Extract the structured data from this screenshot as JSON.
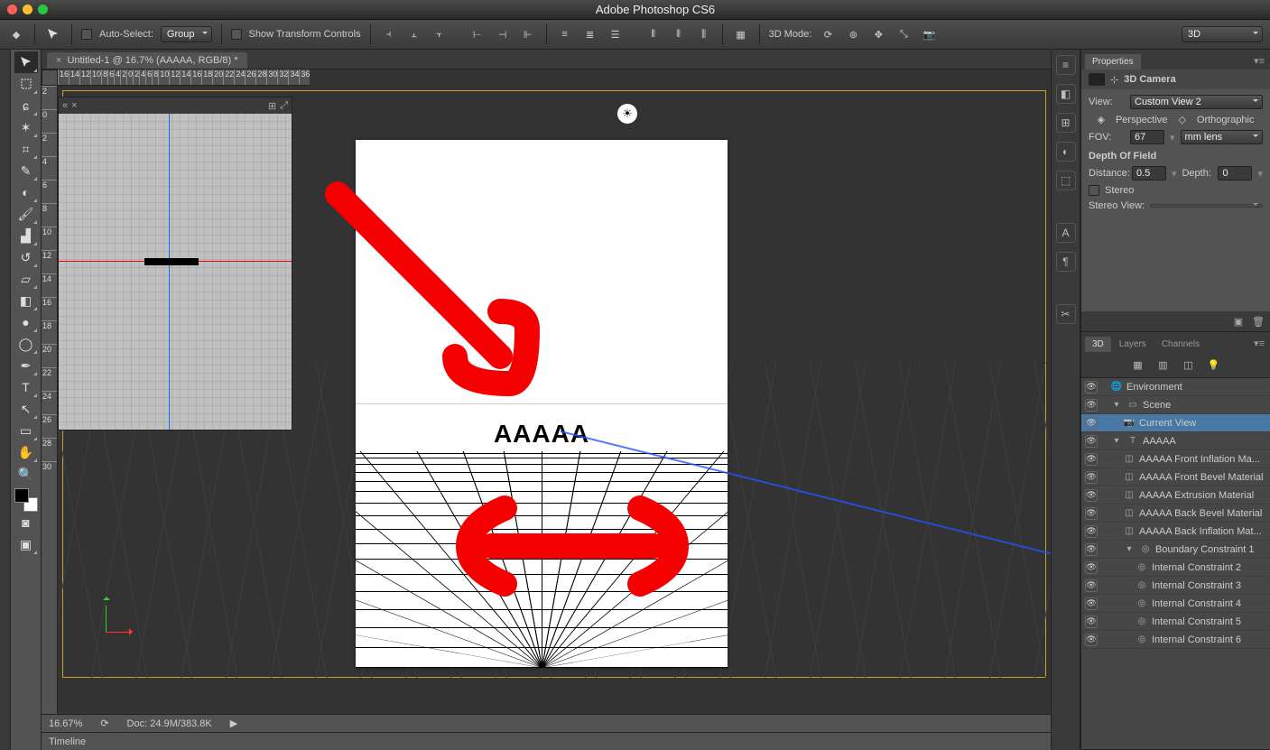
{
  "titlebar": {
    "title": "Adobe Photoshop CS6"
  },
  "options": {
    "auto_select_label": "Auto-Select:",
    "auto_select_target": "Group",
    "show_transform_label": "Show Transform Controls",
    "mode_3d_label": "3D Mode:",
    "right_dd": "3D"
  },
  "document": {
    "tab_label": "Untitled-1 @ 16.7% (AAAAA, RGB/8) *",
    "zoom": "16.67%",
    "doc_size": "Doc: 24.9M/383.8K",
    "artboard_text": "AAAAA"
  },
  "ruler_h": [
    "16",
    "14",
    "12",
    "10",
    "8",
    "6",
    "4",
    "2",
    "0",
    "2",
    "4",
    "6",
    "8",
    "10",
    "12",
    "14",
    "16",
    "18",
    "20",
    "22",
    "24",
    "26",
    "28",
    "30",
    "32",
    "34",
    "36"
  ],
  "ruler_v": [
    "2",
    "0",
    "2",
    "4",
    "6",
    "8",
    "10",
    "12",
    "14",
    "16",
    "18",
    "20",
    "22",
    "24",
    "26",
    "28",
    "30"
  ],
  "timeline": {
    "label": "Timeline"
  },
  "properties": {
    "tab": "Properties",
    "header": "3D Camera",
    "view_label": "View:",
    "view_value": "Custom View 2",
    "perspective_label": "Perspective",
    "orthographic_label": "Orthographic",
    "fov_label": "FOV:",
    "fov_value": "67",
    "fov_unit": "mm lens",
    "dof_label": "Depth Of Field",
    "distance_label": "Distance:",
    "distance_value": "0.5",
    "depth_label": "Depth:",
    "depth_value": "0",
    "stereo_label": "Stereo",
    "stereo_view_label": "Stereo View:"
  },
  "panel3d": {
    "tabs": [
      "3D",
      "Layers",
      "Channels"
    ],
    "items": [
      {
        "indent": 0,
        "icon": "🌐",
        "label": "Environment",
        "eye": true
      },
      {
        "indent": 0,
        "icon": "▭",
        "label": "Scene",
        "eye": true,
        "disclose": "▾"
      },
      {
        "indent": 1,
        "icon": "📷",
        "label": "Current View",
        "eye": true,
        "sel": true
      },
      {
        "indent": 0,
        "icon": "T",
        "label": "AAAAA",
        "eye": true,
        "disclose": "▾"
      },
      {
        "indent": 1,
        "icon": "◫",
        "label": "AAAAA Front Inflation Ma...",
        "eye": true
      },
      {
        "indent": 1,
        "icon": "◫",
        "label": "AAAAA Front Bevel Material",
        "eye": true
      },
      {
        "indent": 1,
        "icon": "◫",
        "label": "AAAAA Extrusion Material",
        "eye": true
      },
      {
        "indent": 1,
        "icon": "◫",
        "label": "AAAAA Back Bevel Material",
        "eye": true
      },
      {
        "indent": 1,
        "icon": "◫",
        "label": "AAAAA Back Inflation Mat...",
        "eye": true
      },
      {
        "indent": 1,
        "icon": "◎",
        "label": "Boundary Constraint 1",
        "eye": true,
        "disclose": "▾"
      },
      {
        "indent": 2,
        "icon": "◎",
        "label": "Internal Constraint 2",
        "eye": true
      },
      {
        "indent": 2,
        "icon": "◎",
        "label": "Internal Constraint 3",
        "eye": true
      },
      {
        "indent": 2,
        "icon": "◎",
        "label": "Internal Constraint 4",
        "eye": true
      },
      {
        "indent": 2,
        "icon": "◎",
        "label": "Internal Constraint 5",
        "eye": true
      },
      {
        "indent": 2,
        "icon": "◎",
        "label": "Internal Constraint 6",
        "eye": true
      }
    ]
  }
}
